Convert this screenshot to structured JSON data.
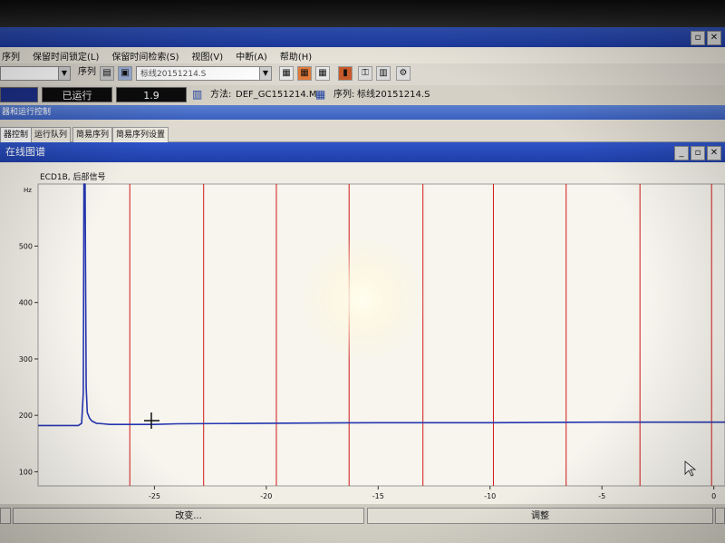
{
  "menu": {
    "items": [
      "序列",
      "保留时间锁定(L)",
      "保留时间检索(S)",
      "视图(V)",
      "中断(A)",
      "帮助(H)"
    ]
  },
  "toolbar": {
    "sequence_label": "序列",
    "sequence_value": "标线20151214.S"
  },
  "status": {
    "state": "已运行",
    "value": "1.9",
    "method_label": "方法:",
    "method_value": "DEF_GC151214.M",
    "sequence_label": "序列:",
    "sequence_value": "标线20151214.S"
  },
  "section": {
    "title": "器和运行控制"
  },
  "tabs": [
    "器控制",
    "运行队列",
    "简易序列",
    "简易序列设置"
  ],
  "online_chart": {
    "window_title": "在线图谱",
    "signal_label": "ECD1B, 后部信号",
    "y_unit": "Hz"
  },
  "footer": {
    "change_label": "改变...",
    "adjust_label": "调整"
  },
  "chart_data": {
    "type": "line",
    "title": "ECD1B, 后部信号",
    "ylabel": "Hz",
    "xlabel": "",
    "x_ticks": [
      "-25",
      "-20",
      "-15",
      "-10",
      "-5",
      "0"
    ],
    "y_ticks": [
      "100",
      "200",
      "300",
      "400",
      "500"
    ],
    "xlim": [
      -30.2,
      0.5
    ],
    "ylim": [
      75,
      610
    ],
    "vertical_markers": [
      -26.1,
      -22.8,
      -19.55,
      -16.3,
      -13.0,
      -9.85,
      -6.6,
      -3.3,
      -0.1
    ],
    "series": [
      {
        "color": "#2535b0",
        "x": [
          -30.2,
          -28.9,
          -28.4,
          -28.25,
          -28.18,
          -28.15,
          -28.1,
          -28.05,
          -28.0,
          -27.9,
          -27.8,
          -27.6,
          -27.3,
          -27.0,
          -26.5,
          -26.0,
          -25.0,
          -24.0,
          -20.0,
          -15.0,
          -10.0,
          -5.0,
          -1.0,
          0.5
        ],
        "y": [
          182,
          182,
          182,
          186,
          240,
          610,
          610,
          250,
          205,
          195,
          190,
          186,
          185,
          184,
          184,
          184,
          184,
          185,
          186,
          187,
          187,
          188,
          188,
          188
        ]
      }
    ]
  }
}
